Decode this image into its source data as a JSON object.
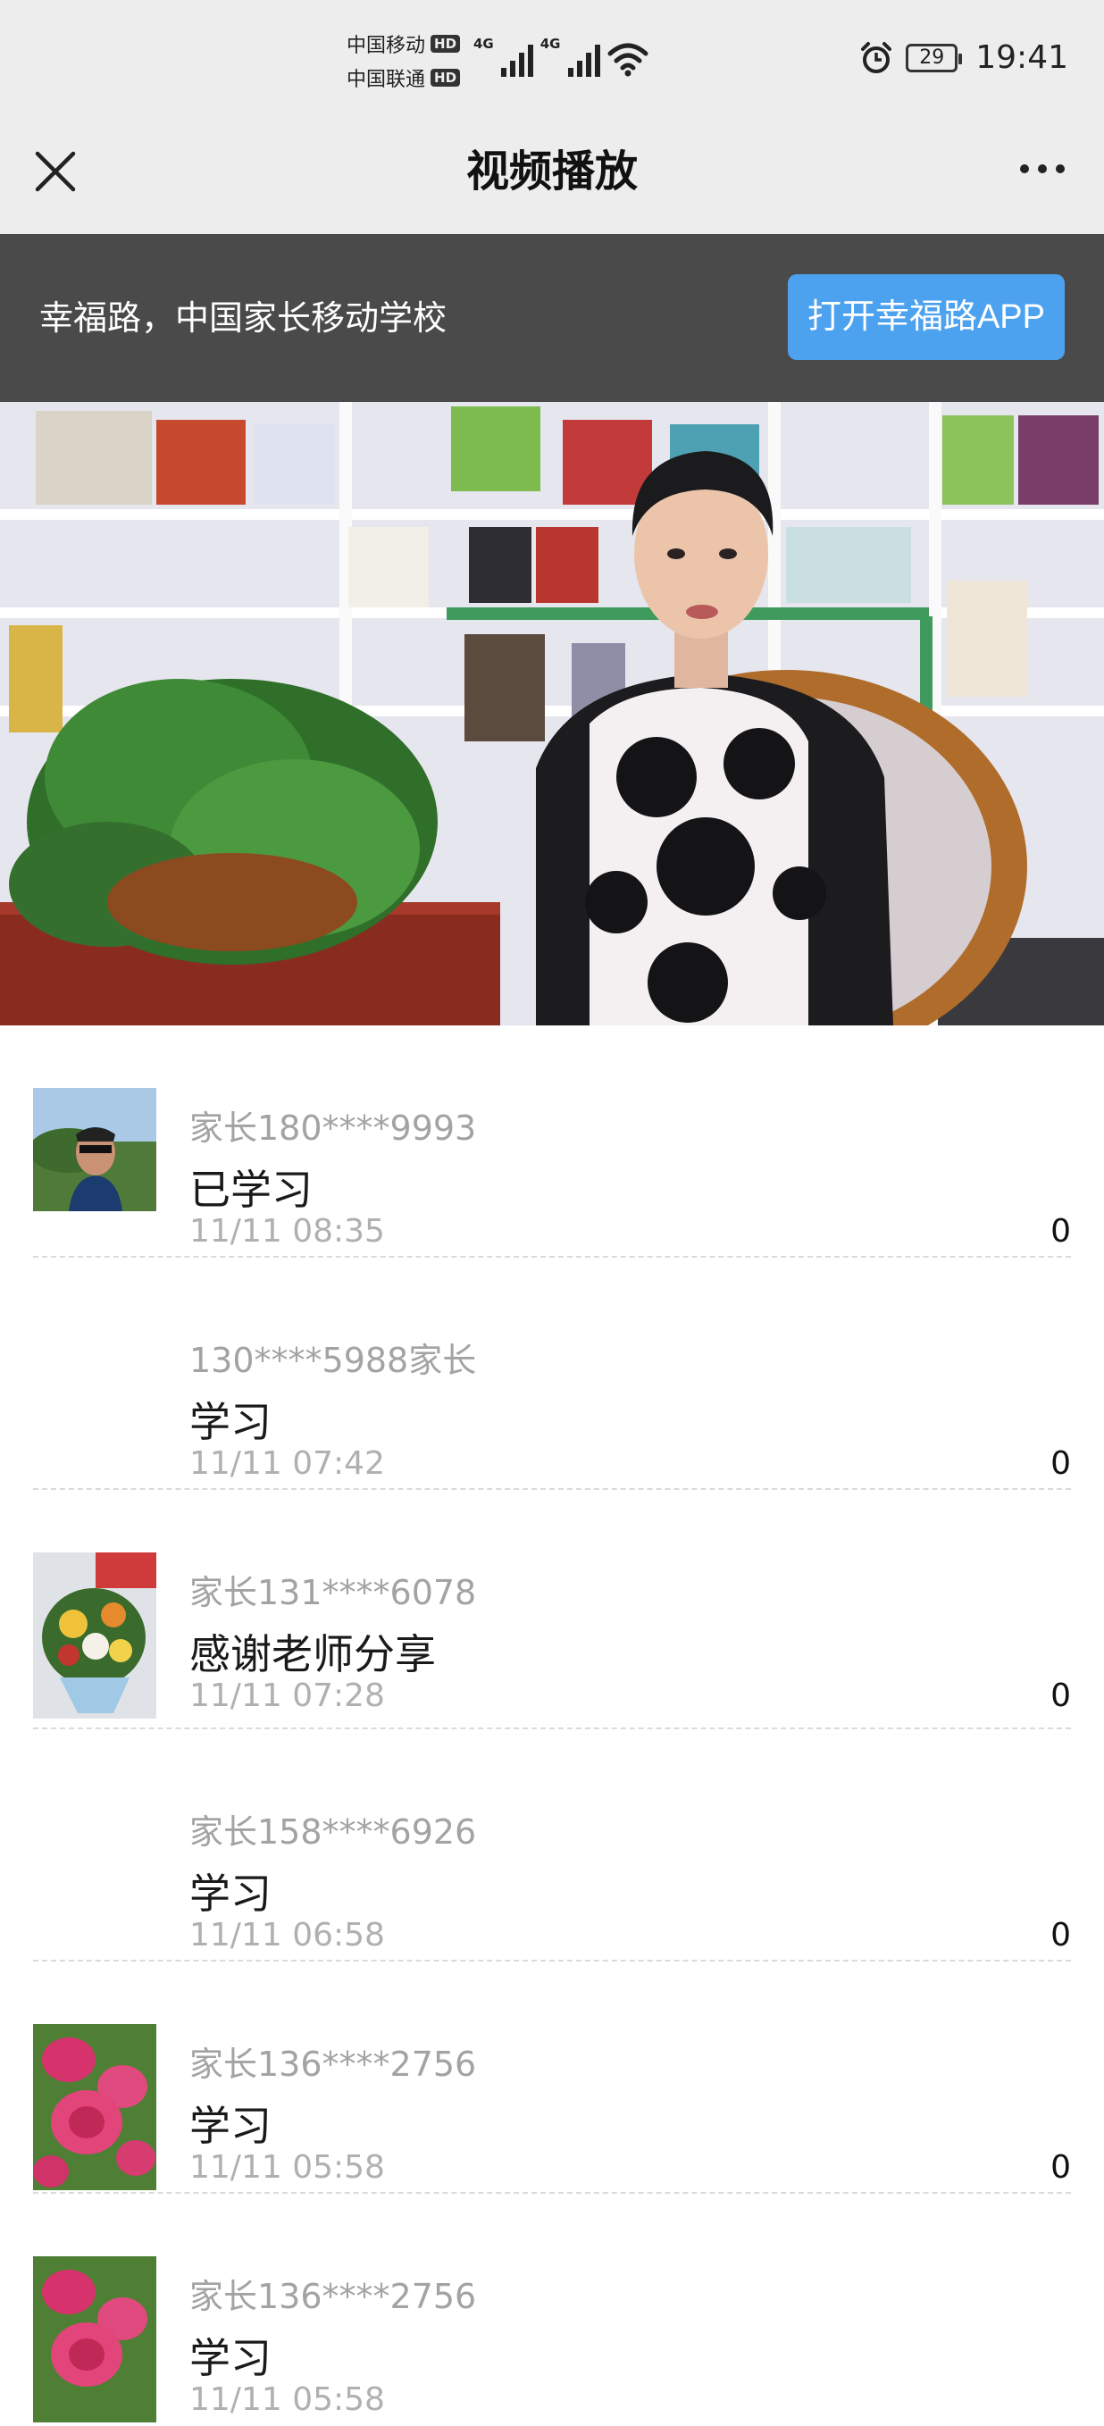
{
  "status_bar": {
    "carrier1": "中国移动",
    "carrier2": "中国联通",
    "hd": "HD",
    "network": "4G",
    "battery": "29",
    "time": "19:41"
  },
  "header": {
    "title": "视频播放"
  },
  "promo": {
    "text": "幸福路，中国家长移动学校",
    "button": "打开幸福路APP"
  },
  "comments": [
    {
      "user": "家长180****9993",
      "text": "已学习",
      "time": "11/11 08:35",
      "likes": "0",
      "avatar": "photo-man"
    },
    {
      "user": "130****5988家长",
      "text": "学习",
      "time": "11/11 07:42",
      "likes": "0",
      "avatar": "none"
    },
    {
      "user": "家长131****6078",
      "text": "感谢老师分享",
      "time": "11/11 07:28",
      "likes": "0",
      "avatar": "photo-bouquet"
    },
    {
      "user": "家长158****6926",
      "text": "学习",
      "time": "11/11 06:58",
      "likes": "0",
      "avatar": "none"
    },
    {
      "user": "家长136****2756",
      "text": "学习",
      "time": "11/11 05:58",
      "likes": "0",
      "avatar": "photo-roses"
    },
    {
      "user": "家长136****2756",
      "text": "学习",
      "time": "11/11 05:58",
      "likes": "",
      "avatar": "photo-roses"
    }
  ],
  "colors": {
    "accent": "#4da2ef",
    "banner": "#4a4a4a",
    "topbar": "#ededed"
  }
}
